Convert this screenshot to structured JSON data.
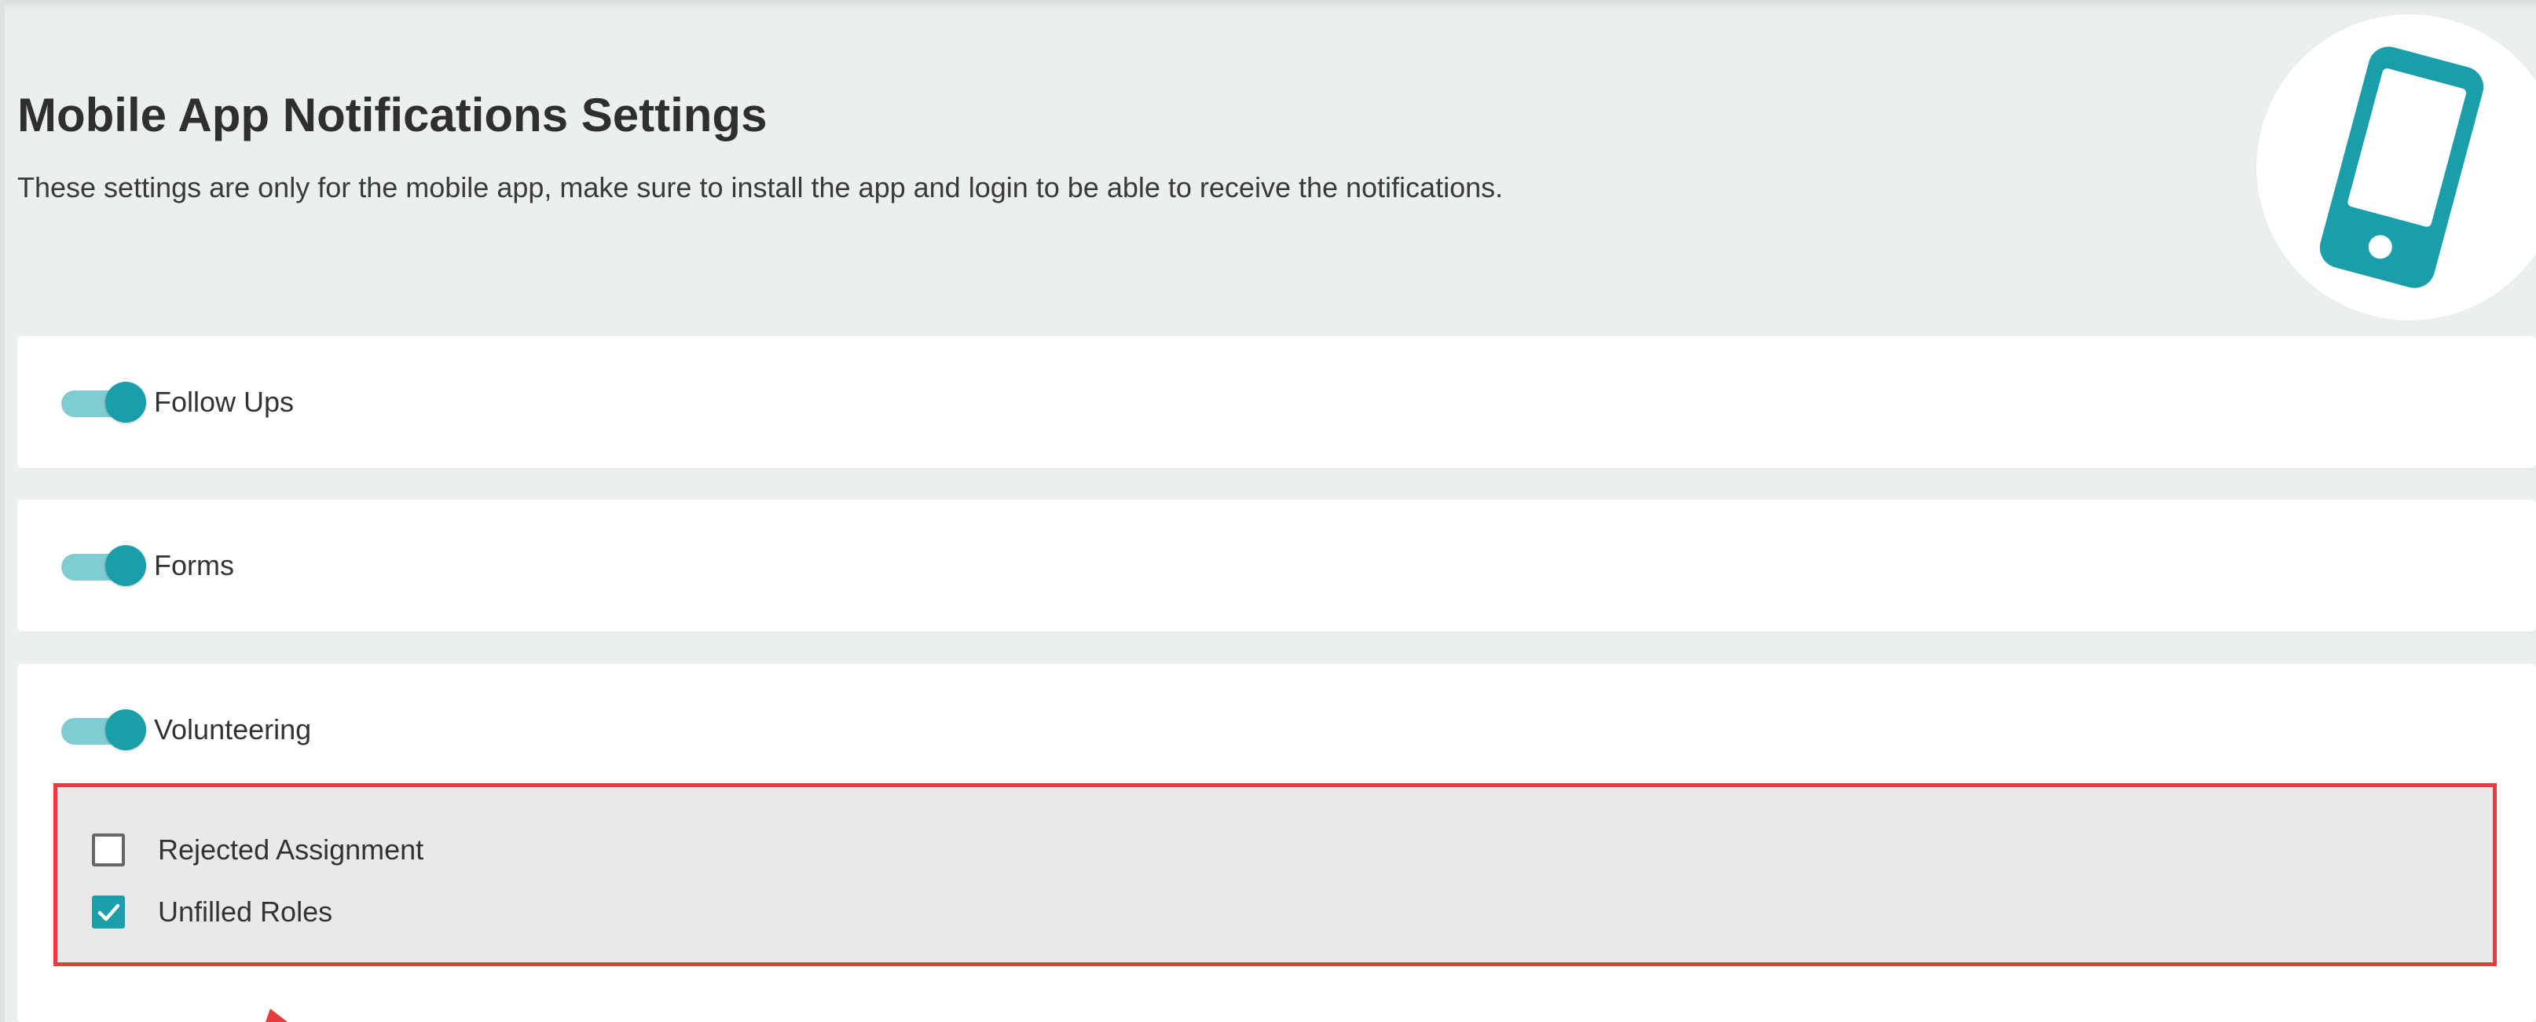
{
  "header": {
    "title": "Mobile App Notifications Settings",
    "subtitle": "These settings are only for the mobile app, make sure to install the app and login to be able to receive the notifications."
  },
  "notification_settings": [
    {
      "label": "Follow Ups",
      "enabled": true
    },
    {
      "label": "Forms",
      "enabled": true
    },
    {
      "label": "Volunteering",
      "enabled": true,
      "options": [
        {
          "label": "Rejected Assignment",
          "checked": false
        },
        {
          "label": "Unfilled Roles",
          "checked": true
        }
      ]
    }
  ],
  "icons": {
    "header_illustration": "mobile-phone-icon"
  },
  "colors": {
    "accent": "#1a9eaa",
    "toggle_track": "#80ccd3",
    "highlight_border": "#e53d3d",
    "page_background": "#eceff0"
  }
}
